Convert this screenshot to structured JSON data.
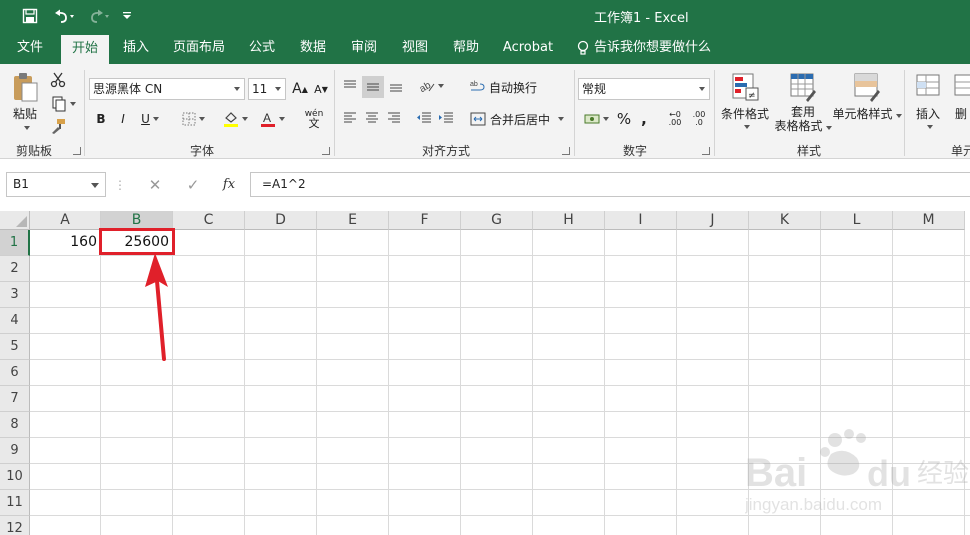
{
  "window": {
    "title": "工作簿1  -  Excel"
  },
  "qat": {
    "save_icon": "save-icon",
    "undo_icon": "undo-icon",
    "redo_icon": "redo-icon",
    "customize_icon": "customize-qat-icon"
  },
  "tabs": [
    {
      "label": "文件"
    },
    {
      "label": "开始"
    },
    {
      "label": "插入"
    },
    {
      "label": "页面布局"
    },
    {
      "label": "公式"
    },
    {
      "label": "数据"
    },
    {
      "label": "审阅"
    },
    {
      "label": "视图"
    },
    {
      "label": "帮助"
    },
    {
      "label": "Acrobat"
    }
  ],
  "active_tab": "开始",
  "tell_me": "告诉我你想要做什么",
  "ribbon": {
    "clipboard": {
      "paste": "粘贴",
      "group": "剪贴板"
    },
    "font": {
      "name": "思源黑体 CN",
      "size": "11",
      "bold": "B",
      "italic": "I",
      "underline": "U",
      "grow": "A",
      "shrink": "A",
      "group": "字体",
      "phonetic": "wén"
    },
    "alignment": {
      "wrap": "自动换行",
      "merge": "合并后居中",
      "group": "对齐方式"
    },
    "number": {
      "format": "常规",
      "percent": "%",
      "comma": ",",
      "group": "数字",
      "inc_decimal": ".00",
      "dec_decimal": ".0"
    },
    "styles": {
      "conditional_line1": "条件格式",
      "table_line1": "套用",
      "table_line2": "表格格式",
      "cell_styles": "单元格样式",
      "group": "样式"
    },
    "cells": {
      "insert": "插入",
      "delete": "删",
      "group": "单元"
    }
  },
  "formula_bar": {
    "name_box": "B1",
    "formula": "=A1^2",
    "fx": "fx",
    "cancel": "✕",
    "enter": "✓"
  },
  "columns": [
    "A",
    "B",
    "C",
    "D",
    "E",
    "F",
    "G",
    "H",
    "I",
    "J",
    "K",
    "L",
    "M"
  ],
  "rows": [
    "1",
    "2",
    "3",
    "4",
    "5",
    "6",
    "7",
    "8",
    "9",
    "10",
    "11",
    "12"
  ],
  "cells": {
    "A1": "160",
    "B1": "25600"
  },
  "selected_cell": "B1",
  "accent_color": "#217346",
  "annotation_color": "#e0202a",
  "watermark": {
    "line1": "Bai",
    "line2": "du",
    "line3": "经验",
    "url": "jingyan.baidu.com"
  }
}
